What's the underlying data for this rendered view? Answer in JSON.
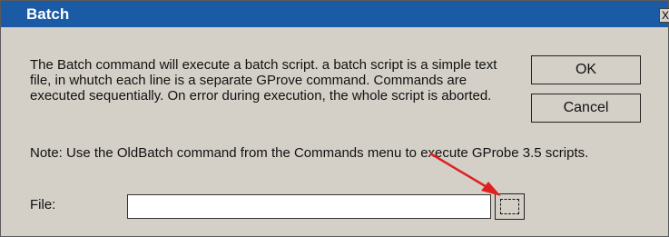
{
  "window": {
    "title": "Batch",
    "close_label": "X"
  },
  "description": "The Batch command will execute a batch script. a batch script is a simple text file, in whutch each line is a separate GProve command. Commands are executed sequentially. On error during execution, the whole script is aborted.",
  "buttons": {
    "ok": "OK",
    "cancel": "Cancel"
  },
  "note": "Note: Use the OldBatch command from the Commands menu to execute GProbe 3.5 scripts.",
  "file": {
    "label": "File:",
    "value": "",
    "placeholder": ""
  },
  "colors": {
    "titlebar": "#1b5aa5",
    "window_bg": "#d4d0c8",
    "arrow": "#e02020"
  },
  "icons": {
    "browse": "browse-icon",
    "annotation": "red-arrow-icon"
  }
}
